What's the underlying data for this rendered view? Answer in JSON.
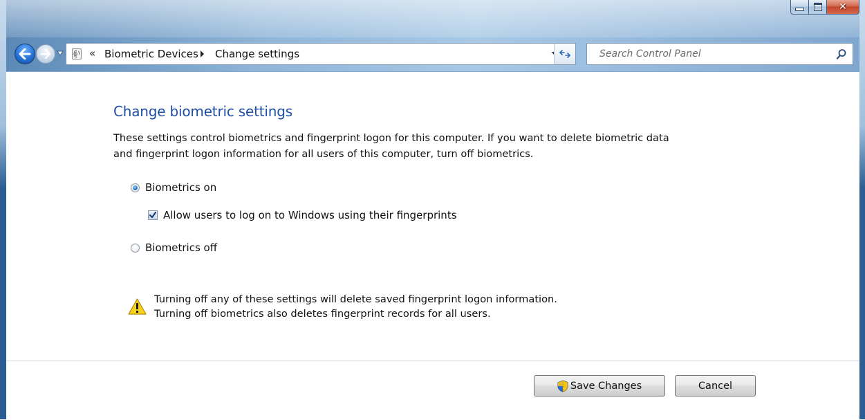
{
  "window": {
    "caption_buttons": [
      "minimize",
      "maximize",
      "close"
    ]
  },
  "navigation": {
    "back_icon": "back-arrow-icon",
    "forward_icon": "forward-arrow-icon",
    "recent_icon": "recent-pages-icon"
  },
  "address": {
    "icon": "biometric-devices-icon",
    "overflow": "«",
    "breadcrumbs": [
      "Biometric Devices",
      "Change settings"
    ],
    "dropdown_icon": "chevron-down-icon",
    "refresh_icon": "refresh-icon"
  },
  "search": {
    "placeholder": "Search Control Panel",
    "icon": "search-icon"
  },
  "main": {
    "title": "Change biometric settings",
    "description_line1": "These settings control biometrics and fingerprint logon for this computer. If you want to delete biometric data",
    "description_line2": "and fingerprint logon information for all users of this computer, turn off biometrics.",
    "options": {
      "biometrics_on": {
        "label": "Biometrics on",
        "selected": true
      },
      "allow_fingerprint_logon": {
        "label": "Allow users to log on to Windows using their fingerprints",
        "checked": true
      },
      "biometrics_off": {
        "label": "Biometrics off",
        "selected": false
      }
    },
    "warning": {
      "icon": "warning-icon",
      "line1": "Turning off any of these settings will delete saved fingerprint logon information.",
      "line2": "Turning off biometrics also deletes fingerprint records for all users."
    }
  },
  "footer": {
    "save_label": "Save Changes",
    "save_icon": "uac-shield-icon",
    "cancel_label": "Cancel"
  },
  "colors": {
    "title": "#1e4ea8",
    "frame": "#8fb5d8",
    "close_button": "#c1452a"
  }
}
